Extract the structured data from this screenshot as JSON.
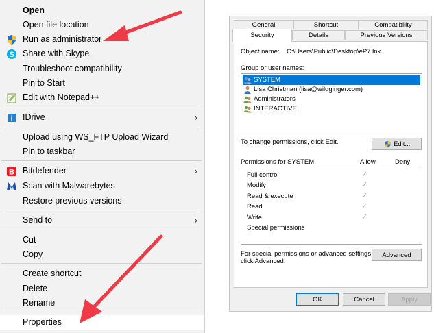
{
  "context_menu": {
    "items": [
      {
        "label": "Open",
        "icon": ""
      },
      {
        "label": "Open file location",
        "icon": ""
      },
      {
        "label": "Run as administrator",
        "icon": "shield-icon"
      },
      {
        "label": "Share with Skype",
        "icon": "skype-icon"
      },
      {
        "label": "Troubleshoot compatibility",
        "icon": ""
      },
      {
        "label": "Pin to Start",
        "icon": ""
      },
      {
        "label": "Edit with Notepad++",
        "icon": "notepad-plus-plus-icon"
      },
      {
        "label": "IDrive",
        "icon": "idrive-icon",
        "submenu_glyph": "›"
      },
      {
        "label": "Upload using WS_FTP Upload Wizard",
        "icon": ""
      },
      {
        "label": "Pin to taskbar",
        "icon": ""
      },
      {
        "label": "Bitdefender",
        "icon": "bitdefender-icon",
        "submenu_glyph": "›"
      },
      {
        "label": "Scan with Malwarebytes",
        "icon": "malwarebytes-icon"
      },
      {
        "label": "Restore previous versions",
        "icon": ""
      },
      {
        "label": "Send to",
        "icon": "",
        "submenu_glyph": "›"
      },
      {
        "label": "Cut",
        "icon": ""
      },
      {
        "label": "Copy",
        "icon": ""
      },
      {
        "label": "Create shortcut",
        "icon": ""
      },
      {
        "label": "Delete",
        "icon": ""
      },
      {
        "label": "Rename",
        "icon": ""
      },
      {
        "label": "Properties",
        "icon": ""
      }
    ]
  },
  "dialog": {
    "tabs_back": [
      "General",
      "Shortcut",
      "Compatibility"
    ],
    "tabs_front": [
      "Security",
      "Details",
      "Previous Versions"
    ],
    "selected_tab": "Security",
    "object_name_label": "Object name:",
    "object_name_value": "C:\\Users\\Public\\Desktop\\eP7.lnk",
    "group_label": "Group or user names:",
    "users": [
      {
        "name": "SYSTEM",
        "selected": true
      },
      {
        "name": "Lisa Christman (lisa@wildginger.com)",
        "selected": false
      },
      {
        "name": "Administrators",
        "selected": false
      },
      {
        "name": "INTERACTIVE",
        "selected": false
      }
    ],
    "change_text": "To change permissions, click Edit.",
    "edit_button": "Edit...",
    "permissions_label": "Permissions for SYSTEM",
    "allow_header": "Allow",
    "deny_header": "Deny",
    "permissions": [
      {
        "name": "Full control",
        "allow": true
      },
      {
        "name": "Modify",
        "allow": true
      },
      {
        "name": "Read & execute",
        "allow": true
      },
      {
        "name": "Read",
        "allow": true
      },
      {
        "name": "Write",
        "allow": true
      },
      {
        "name": "Special permissions",
        "allow": false
      }
    ],
    "advanced_text_1": "For special permissions or advanced settings,",
    "advanced_text_2": "click Advanced.",
    "advanced_button": "Advanced",
    "ok_button": "OK",
    "cancel_button": "Cancel",
    "apply_button": "Apply"
  },
  "colors": {
    "arrow": "#ef3b48",
    "selection": "#0078d7",
    "checkmark": "#a9a9a9"
  }
}
